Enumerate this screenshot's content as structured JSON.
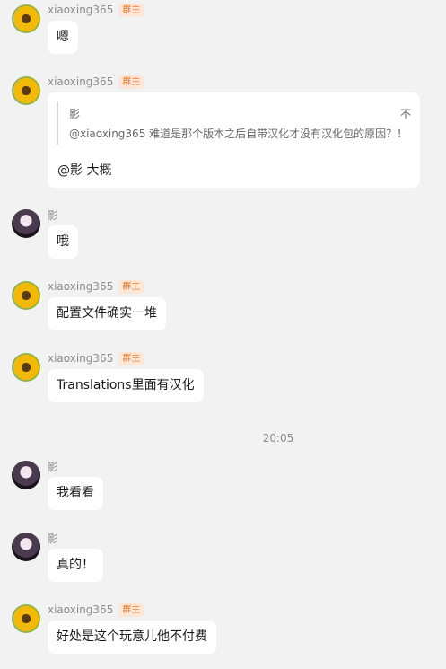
{
  "messages": [
    {
      "sender": "xiaoxing365",
      "badge": "群主",
      "text": "嗯"
    },
    {
      "sender": "xiaoxing365",
      "badge": "群主",
      "quote": {
        "author": "影",
        "close": "不",
        "text": "@xiaoxing365 难道是那个版本之后自带汉化才没有汉化包的原因？！"
      },
      "text": "@影 大概"
    },
    {
      "sender": "影",
      "text": "哦"
    },
    {
      "sender": "xiaoxing365",
      "badge": "群主",
      "text": "配置文件确实一堆"
    },
    {
      "sender": "xiaoxing365",
      "badge": "群主",
      "text": "Translations里面有汉化"
    },
    {
      "sender": "影",
      "text": "我看看"
    },
    {
      "sender": "影",
      "text": "真的！"
    },
    {
      "sender": "xiaoxing365",
      "badge": "群主",
      "text": "好处是这个玩意儿他不付费"
    }
  ],
  "timestamp": "20:05",
  "icons": {
    "owner_avatar": "sunflower-avatar",
    "user_avatar": "anime-girl-avatar"
  }
}
